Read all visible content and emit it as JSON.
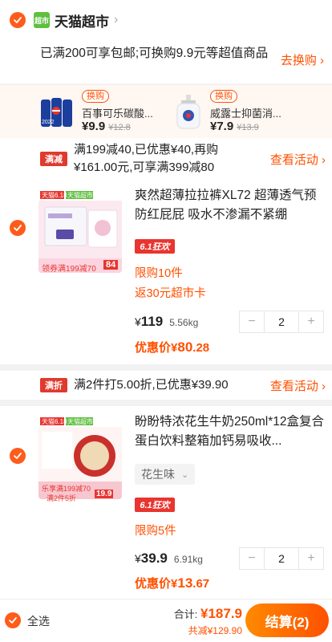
{
  "store": {
    "logo_text": "超市",
    "name": "天猫超市",
    "chevron": "›"
  },
  "shipping": {
    "text": "已满200可享包邮;可换购9.9元等超值商品",
    "link": "去换购 ›"
  },
  "exchange": [
    {
      "tag": "换购",
      "name": "百事可乐碳酸...",
      "price": "¥9.9",
      "old_price": "¥12.8"
    },
    {
      "tag": "换购",
      "name": "威露士抑菌消...",
      "price": "¥7.9",
      "old_price": "¥13.9"
    }
  ],
  "promo1": {
    "tag": "满减",
    "text": "满199减40,已优惠¥40,再购¥161.00元,可享满399减80",
    "link": "查看活动 ›"
  },
  "product1": {
    "img_badge1": "天猫6.18",
    "img_badge2": "天猫超市",
    "img_bottom": "领券满199减70",
    "img_price": "84",
    "title": "爽然超薄拉拉裤XL72 超薄透气预防红屁屁 吸水不渗漏不紧绷",
    "festival": "6.1狂欢",
    "limit": "限购10件",
    "rebate": "返30元超市卡",
    "price_symbol": "¥",
    "price": "119",
    "weight": "5.56kg",
    "qty": "2",
    "minus": "−",
    "plus": "+",
    "disc_label": "优惠价",
    "disc_symbol": "¥",
    "disc_int": "80",
    "disc_dec": ".28"
  },
  "promo2": {
    "tag": "满折",
    "text": "满2件打5.00折,已优惠¥39.90",
    "link": "查看活动 ›"
  },
  "product2": {
    "img_badge1": "天猫6.18",
    "img_badge2": "天猫超市",
    "img_bottom": "乐享满199减70",
    "img_sub": "满2件5折",
    "img_price": "19.9",
    "title": "盼盼特浓花生牛奶250ml*12盒复合蛋白饮料整箱加钙易吸收...",
    "variant": "花生味",
    "festival": "6.1狂欢",
    "limit": "限购5件",
    "price_symbol": "¥",
    "price": "39.9",
    "weight": "6.91kg",
    "qty": "2",
    "minus": "−",
    "plus": "+",
    "disc_label": "优惠价",
    "disc_symbol": "¥",
    "disc_int": "13",
    "disc_dec": ".67"
  },
  "footer": {
    "select_all": "全选",
    "total_label": "合计:",
    "total": "¥187.9",
    "saved": "共减¥129.90",
    "checkout": "结算(2)"
  },
  "colors": {
    "accent": "#ff5000",
    "check": "#ff5b1a",
    "tmall_green": "#5fbf3f"
  }
}
